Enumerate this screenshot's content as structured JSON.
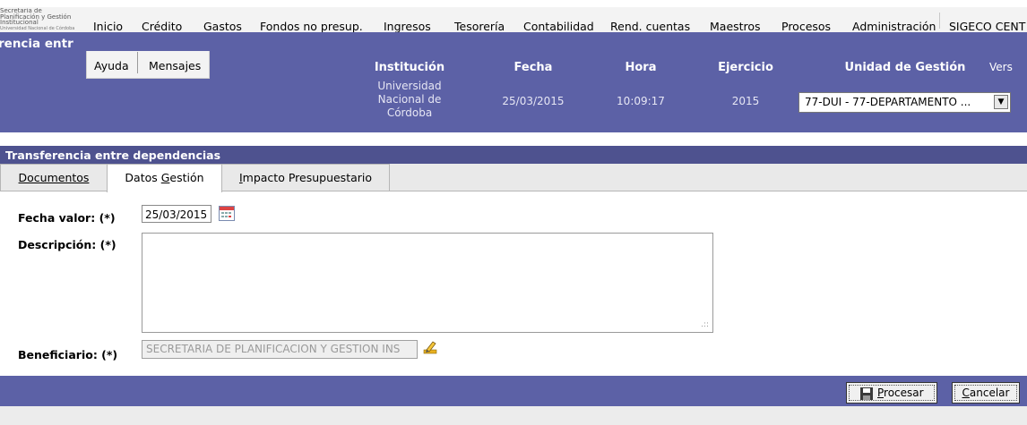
{
  "logo": {
    "line1": "Secretaría de",
    "line2": "Planificación y Gestión",
    "line3": "Institucional",
    "line4": "Universidad Nacional de Córdoba"
  },
  "menu": {
    "items": [
      "Inicio",
      "Crédito",
      "Gastos",
      "Fondos no presup.",
      "Ingresos",
      "Tesorería",
      "Contabilidad",
      "Rend. cuentas",
      "Maestros",
      "Procesos",
      "Administración",
      "SIGECO CENT"
    ]
  },
  "submenu": {
    "items": [
      "Ayuda",
      "Mensajes"
    ]
  },
  "header": {
    "page_title": "rencia entr",
    "institucion_label": "Institución",
    "institucion_value_1": "Universidad",
    "institucion_value_2": "Nacional de",
    "institucion_value_3": "Córdoba",
    "fecha_label": "Fecha",
    "fecha_value": "25/03/2015",
    "hora_label": "Hora",
    "hora_value": "10:09:17",
    "ejercicio_label": "Ejercicio",
    "ejercicio_value": "2015",
    "unidad_label": "Unidad de Gestión",
    "unidad_value": "77-DUI - 77-DEPARTAMENTO ...",
    "version_label": "Vers"
  },
  "section": {
    "title": "Transferencia entre dependencias"
  },
  "tabs": {
    "documentos": "Documentos",
    "datos_gestion_pre": "Datos ",
    "datos_gestion_u": "G",
    "datos_gestion_post": "estión",
    "impacto_u": "I",
    "impacto_post": "mpacto Presupuestario"
  },
  "form": {
    "fecha_valor_label": "Fecha valor: (*)",
    "fecha_valor_value": "25/03/2015",
    "descripcion_label": "Descripción: (*)",
    "descripcion_value": "",
    "beneficiario_label": "Beneficiario: (*)",
    "beneficiario_value": "SECRETARIA DE PLANIFICACION Y GESTION INS"
  },
  "buttons": {
    "procesar_u": "P",
    "procesar_post": "rocesar",
    "cancelar_u": "C",
    "cancelar_post": "ancelar"
  },
  "colors": {
    "header_bg": "#5c61a6",
    "section_bg": "#4e528f"
  }
}
